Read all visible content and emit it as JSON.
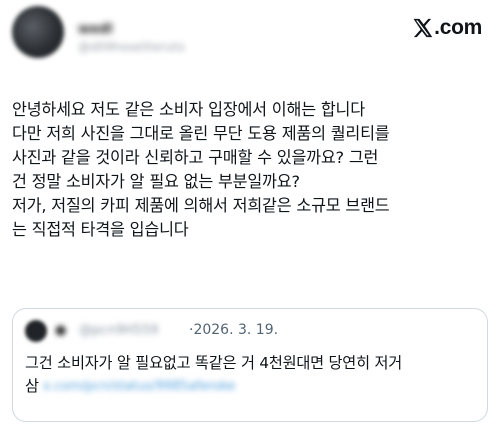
{
  "header": {
    "author_name": "wedl",
    "author_handle": "@d09hoseliteruto",
    "brand": "X.com"
  },
  "tweet": {
    "lines": [
      "안녕하세요 저도 같은 소비자 입장에서 이해는 합니다",
      "다만 저희 사진을 그대로 올린 무단 도용 제품의 퀄리티를",
      "사진과 같을 것이라 신뢰하고 구매할 수 있을까요? 그런",
      "건 정말 소비자가 알 필요 없는 부분일까요?",
      "저가, 저질의 카피 제품에 의해서 저희같은 소규모 브랜드",
      "는 직접적 타격을 입습니다"
    ]
  },
  "quote": {
    "author_name": "●",
    "author_handle": "@pcn9H559",
    "date": "·2026. 3. 19.",
    "lines": [
      "그건 소비자가 알 필요없고 똑같은 거 4천원대면 당연히 저거",
      "삼"
    ],
    "link_text": "x.com/pcn/status/9985aferoke"
  },
  "colors": {
    "text": "#0f1419",
    "secondary": "#536471",
    "border": "#cfd9de",
    "link": "#5aa4de"
  }
}
